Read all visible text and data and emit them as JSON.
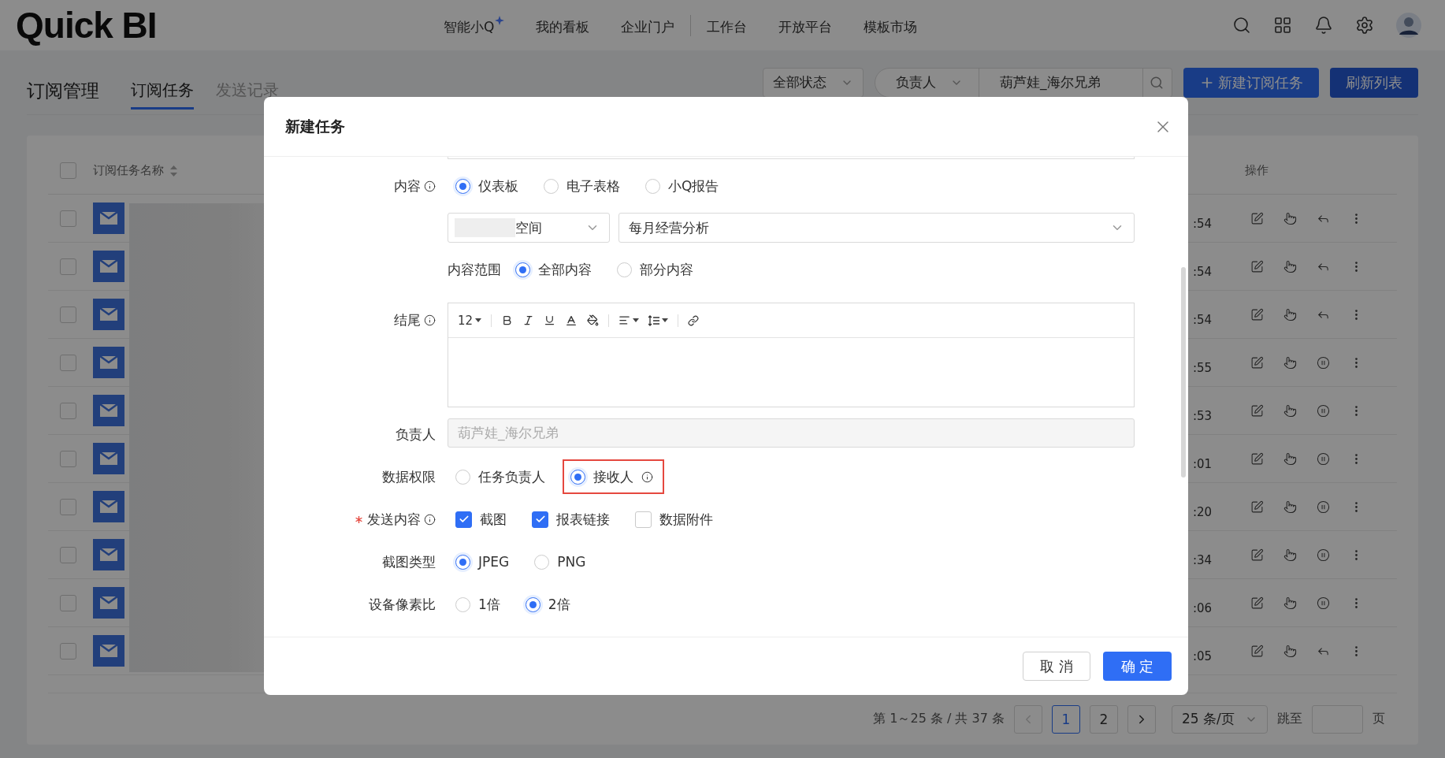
{
  "topbar": {
    "logo": "Quick BI",
    "nav": [
      {
        "label": "智能小Q",
        "sparkle": true,
        "separated": false
      },
      {
        "label": "我的看板",
        "sparkle": false,
        "separated": false
      },
      {
        "label": "企业门户",
        "sparkle": false,
        "separated": false
      },
      {
        "label": "工作台",
        "sparkle": false,
        "separated": true
      },
      {
        "label": "开放平台",
        "sparkle": false,
        "separated": false
      },
      {
        "label": "模板市场",
        "sparkle": false,
        "separated": false
      }
    ]
  },
  "page": {
    "title": "订阅管理",
    "tabs": [
      {
        "label": "订阅任务",
        "selected": true
      },
      {
        "label": "发送记录",
        "selected": false
      }
    ],
    "filters": {
      "status": "全部状态",
      "owner_type": "负责人",
      "owner": "葫芦娃_海尔兄弟"
    },
    "buttons": [
      {
        "label": "新建订阅任务",
        "kind": "primary"
      },
      {
        "label": "刷新列表",
        "kind": "secondary"
      }
    ]
  },
  "table": {
    "all_checked": false,
    "columns": [
      "订阅任务名称",
      "操作"
    ],
    "rows": [
      {
        "checked": false,
        "time": ":54",
        "kind": "revoke"
      },
      {
        "checked": false,
        "time": ":54",
        "kind": "revoke"
      },
      {
        "checked": false,
        "time": ":54",
        "kind": "revoke"
      },
      {
        "checked": false,
        "time": ":55",
        "kind": "pause"
      },
      {
        "checked": false,
        "time": ":53",
        "kind": "pause"
      },
      {
        "checked": false,
        "time": ":01",
        "kind": "pause"
      },
      {
        "checked": false,
        "time": ":20",
        "kind": "pause"
      },
      {
        "checked": false,
        "time": ":34",
        "kind": "pause"
      },
      {
        "checked": false,
        "time": ":06",
        "kind": "pause"
      },
      {
        "checked": false,
        "time": ":05",
        "kind": "revoke"
      }
    ]
  },
  "pagination": {
    "summary": "第 1～25 条 / 共 37 条",
    "pages": [
      {
        "label": "1",
        "selected": true
      },
      {
        "label": "2",
        "selected": false
      }
    ],
    "prev_disabled": true,
    "page_size": "25 条/页",
    "jump_label": "跳至",
    "page_unit": "页"
  },
  "dialog": {
    "title": "新建任务",
    "fields": [
      {
        "kind": "radio",
        "label": "内容",
        "info": true,
        "required": false,
        "options": [
          {
            "label": "仪表板",
            "selected": true,
            "info": false,
            "highlighted": false
          },
          {
            "label": "电子表格",
            "selected": false,
            "info": false,
            "highlighted": false
          },
          {
            "label": "小Q报告",
            "selected": false,
            "info": false,
            "highlighted": false
          }
        ]
      },
      {
        "kind": "selects",
        "space_suffix": "空间",
        "report": "每月经营分析"
      },
      {
        "kind": "scope",
        "label": "内容范围",
        "options": [
          {
            "label": "全部内容",
            "selected": true,
            "info": false,
            "highlighted": false
          },
          {
            "label": "部分内容",
            "selected": false,
            "info": false,
            "highlighted": false
          }
        ]
      },
      {
        "kind": "editor",
        "label": "结尾",
        "info": true,
        "required": false,
        "font_size": "12"
      },
      {
        "kind": "readonly",
        "label": "负责人",
        "info": false,
        "required": false,
        "value": "葫芦娃_海尔兄弟"
      },
      {
        "kind": "radio",
        "label": "数据权限",
        "info": false,
        "required": false,
        "options": [
          {
            "label": "任务负责人",
            "selected": false,
            "info": false,
            "highlighted": false
          },
          {
            "label": "接收人",
            "selected": true,
            "info": true,
            "highlighted": true
          }
        ]
      },
      {
        "kind": "checkbox",
        "label": "发送内容",
        "info": true,
        "required": true,
        "options": [
          {
            "label": "截图",
            "checked": true
          },
          {
            "label": "报表链接",
            "checked": true
          },
          {
            "label": "数据附件",
            "checked": false
          }
        ]
      },
      {
        "kind": "radio",
        "label": "截图类型",
        "info": false,
        "required": false,
        "options": [
          {
            "label": "JPEG",
            "selected": true,
            "info": false,
            "highlighted": false
          },
          {
            "label": "PNG",
            "selected": false,
            "info": false,
            "highlighted": false
          }
        ]
      },
      {
        "kind": "radio",
        "label": "设备像素比",
        "info": false,
        "required": false,
        "options": [
          {
            "label": "1倍",
            "selected": false,
            "info": false,
            "highlighted": false
          },
          {
            "label": "2倍",
            "selected": true,
            "info": false,
            "highlighted": false
          }
        ]
      }
    ],
    "buttons": [
      {
        "label": "取 消",
        "kind": "default"
      },
      {
        "label": "确 定",
        "kind": "primary"
      }
    ]
  }
}
